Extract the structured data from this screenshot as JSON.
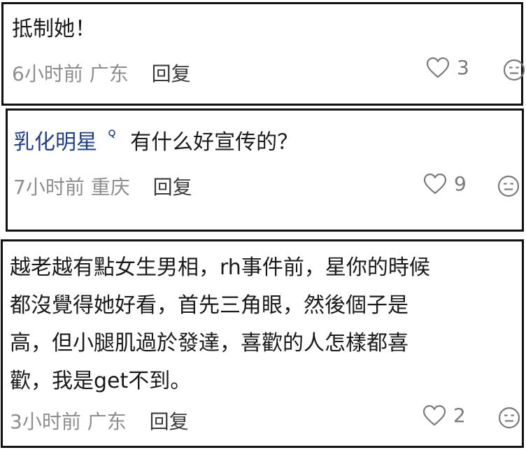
{
  "comments": [
    {
      "text": "抵制她！",
      "time": "6小时前",
      "location": "广东",
      "reply_label": "回复",
      "likes": "3"
    },
    {
      "username": "乳化明星",
      "text": "有什么好宣传的？",
      "time": "7小时前",
      "location": "重庆",
      "reply_label": "回复",
      "likes": "9"
    },
    {
      "lines": [
        "越老越有點女生男相，rh事件前，星你的時候",
        "都沒覺得她好看，首先三角眼，然後個子是",
        "高，但小腿肌過於發達，喜歡的人怎樣都喜",
        "歡，我是get不到。"
      ],
      "time": "3小时前",
      "location": "广东",
      "reply_label": "回复",
      "likes": "2"
    }
  ],
  "icons": {
    "like": "heart-outline-icon",
    "reaction": "neutral-face-icon"
  },
  "colors": {
    "username": "#1f3f86",
    "meta": "#8e8e8e",
    "border": "#111111"
  }
}
